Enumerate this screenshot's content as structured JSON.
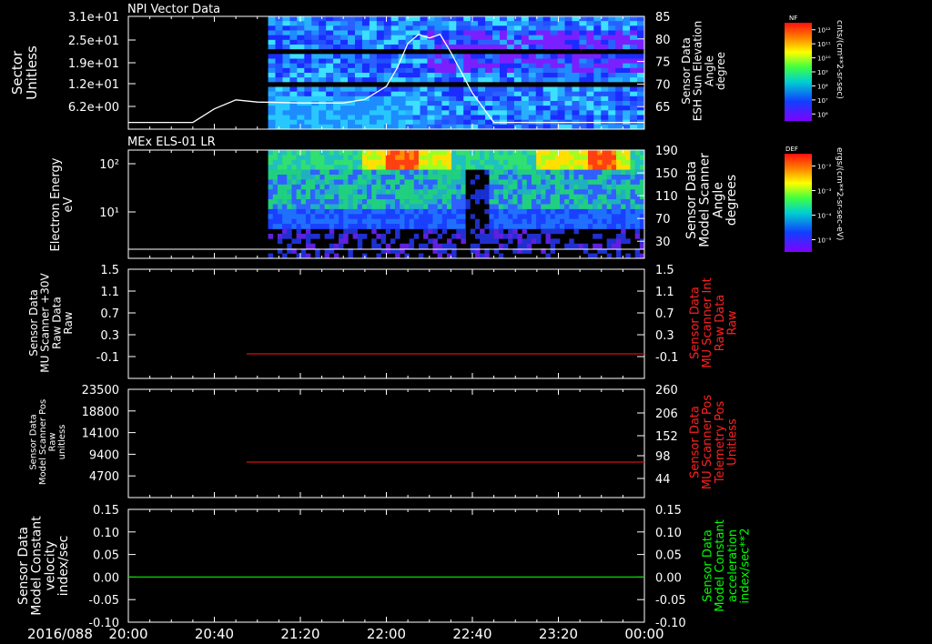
{
  "page": {
    "bottom_date": "2016/088",
    "time_ticks": [
      "20:00",
      "20:40",
      "21:20",
      "22:00",
      "22:40",
      "23:20",
      "00:00"
    ],
    "colors": {
      "background": "#000000",
      "axis": "#ffffff",
      "red_trace": "#d01010",
      "green_trace": "#00e000",
      "red_label": "#ff2020",
      "green_label": "#00ff00"
    }
  },
  "colorbars": [
    {
      "tag": "NF",
      "unit_label": "cnts/(cm**2-sr-sec)",
      "tick_labels": [
        "10¹²",
        "10¹¹",
        "10¹⁰",
        "10⁹",
        "10⁸",
        "10⁷",
        "10⁶"
      ]
    },
    {
      "tag": "DEF",
      "unit_label": "ergs/(cm**2-sr-sec-eV)",
      "tick_labels": [
        "10⁻²",
        "10⁻³",
        "10⁻⁴",
        "10⁻⁵"
      ]
    }
  ],
  "chart_data": [
    {
      "type": "heatmap",
      "title": "NPI Vector Data",
      "ylabel": [
        "Sector",
        "Unitless"
      ],
      "y_tick_labels": [
        "3.1e+01",
        "2.5e+01",
        "1.9e+01",
        "1.2e+01",
        "6.2e+00"
      ],
      "right_label": [
        "Sensor Data",
        "ESH Sun Elevation",
        "Angle",
        "degree"
      ],
      "right_tick_labels": [
        "85",
        "80",
        "75",
        "70",
        "65"
      ],
      "right_ylim": [
        60,
        85
      ],
      "data_start": "21:05",
      "overlay_line": {
        "x": [
          "20:00",
          "20:20",
          "20:30",
          "20:40",
          "20:50",
          "21:00",
          "21:20",
          "21:40",
          "21:50",
          "22:00",
          "22:05",
          "22:10",
          "22:15",
          "22:20",
          "22:25",
          "22:30",
          "22:40",
          "22:50",
          "23:00",
          "23:40",
          "00:00"
        ],
        "y": [
          61.5,
          61.5,
          61.5,
          64.5,
          66.5,
          66,
          65.8,
          65.8,
          66.6,
          69.5,
          73.5,
          79,
          81,
          80.2,
          81,
          77,
          68,
          61.5,
          61.5,
          61.5,
          61.5
        ]
      }
    },
    {
      "type": "heatmap",
      "title": "MEx ELS-01 LR",
      "ylabel": [
        "Electron Energy",
        "eV"
      ],
      "y_tick_labels": [
        "10²",
        "10¹"
      ],
      "right_label": [
        "Sensor Data",
        "Model Scanner",
        "Angle",
        "degrees"
      ],
      "right_tick_labels": [
        "190",
        "150",
        "110",
        "70",
        "30"
      ],
      "right_ylim": [
        0,
        190
      ],
      "data_start": "21:05"
    },
    {
      "type": "line",
      "ylabel": [
        "Sensor Data",
        "MU Scanner +30V",
        "Raw Data",
        "Raw"
      ],
      "y_tick_labels": [
        "1.5",
        "1.1",
        "0.7",
        "0.3",
        "-0.1"
      ],
      "ylim": [
        -0.5,
        1.5
      ],
      "right_label": [
        "Sensor Data",
        "MU Scanner Int",
        "Raw Data",
        "Raw"
      ],
      "right_tick_labels": [
        "1.5",
        "1.1",
        "0.7",
        "0.3",
        "-0.1"
      ],
      "series": [
        {
          "color": "red",
          "x": [
            "20:55",
            "00:00"
          ],
          "values": [
            -0.05,
            -0.05
          ]
        }
      ]
    },
    {
      "type": "line",
      "ylabel": [
        "Sensor Data",
        "Model Scanner Pos",
        "Raw",
        "unitless"
      ],
      "y_tick_labels": [
        "23500",
        "18800",
        "14100",
        "9400",
        "4700"
      ],
      "ylim": [
        0,
        23500
      ],
      "right_label": [
        "Sensor Data",
        "MU Scanner Pos",
        "Telemetry Pos",
        "Unitless"
      ],
      "right_tick_labels": [
        "260",
        "206",
        "152",
        "98",
        "44"
      ],
      "series": [
        {
          "color": "red",
          "x": [
            "20:55",
            "00:00"
          ],
          "values": [
            7700,
            7700
          ]
        }
      ]
    },
    {
      "type": "line",
      "ylabel": [
        "Sensor Data",
        "Model Constant",
        "velocity",
        "index/sec"
      ],
      "y_tick_labels": [
        "0.15",
        "0.10",
        "0.05",
        "0.00",
        "-0.05",
        "-0.10"
      ],
      "ylim": [
        -0.1,
        0.15
      ],
      "right_label": [
        "Sensor Data",
        "Model Constant",
        "acceleration",
        "index/sec**2"
      ],
      "right_tick_labels": [
        "0.15",
        "0.10",
        "0.05",
        "0.00",
        "-0.05",
        "-0.10"
      ],
      "series": [
        {
          "color": "green",
          "x": [
            "20:00",
            "00:00"
          ],
          "values": [
            0.0,
            0.0
          ]
        }
      ]
    }
  ]
}
